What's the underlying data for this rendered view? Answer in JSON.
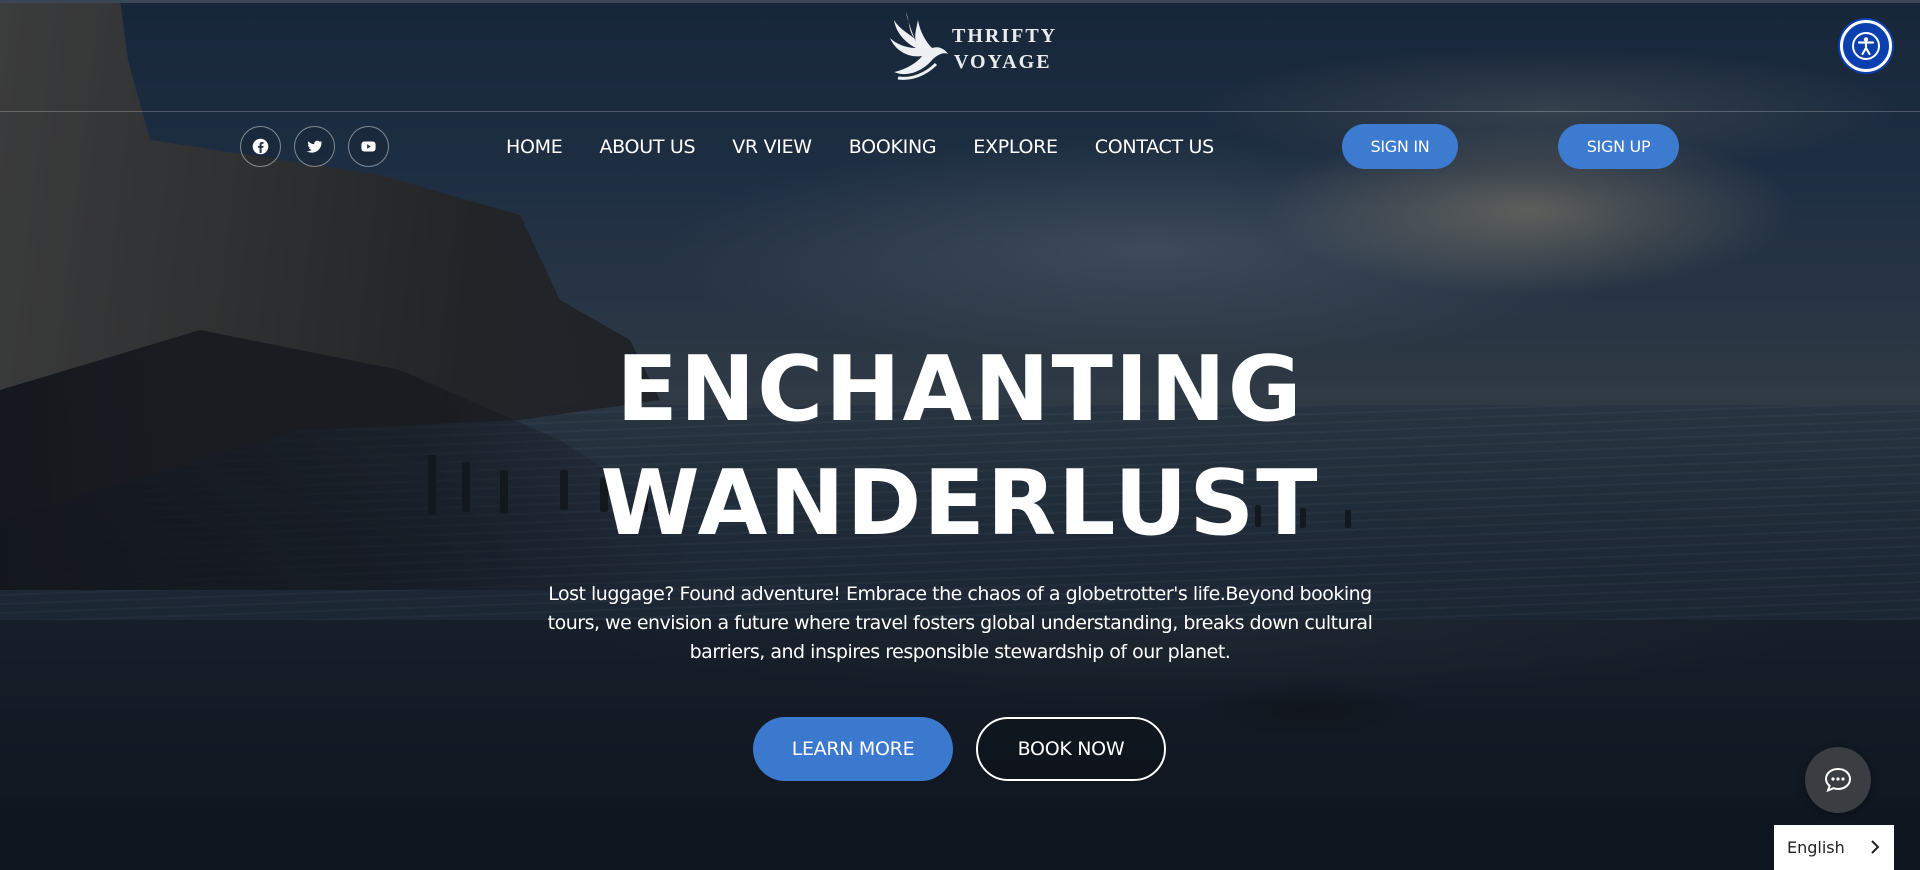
{
  "brand": {
    "line1": "THRIFTY",
    "line2": "VOYAGE",
    "logo_icon": "dove-icon"
  },
  "socials": [
    {
      "icon": "facebook-icon"
    },
    {
      "icon": "twitter-icon"
    },
    {
      "icon": "youtube-icon"
    }
  ],
  "nav": {
    "items": [
      {
        "label": "HOME"
      },
      {
        "label": "ABOUT US"
      },
      {
        "label": "VR VIEW"
      },
      {
        "label": "BOOKING"
      },
      {
        "label": "EXPLORE"
      },
      {
        "label": "CONTACT US"
      }
    ]
  },
  "auth": {
    "signin_label": "SIGN IN",
    "signup_label": "SIGN UP"
  },
  "hero": {
    "title_line1": "ENCHANTING",
    "title_line2": "WANDERLUST",
    "description": "Lost luggage? Found adventure! Embrace the chaos of a globetrotter's life.Beyond booking tours, we envision a future where travel fosters global understanding, breaks down cultural barriers, and inspires responsible stewardship of our planet.",
    "learn_more_label": "LEARN MORE",
    "book_now_label": "BOOK NOW"
  },
  "widgets": {
    "accessibility_icon": "accessibility-icon",
    "chat_icon": "chat-bubble-icon",
    "language": "English"
  },
  "colors": {
    "accent": "#3d7bd0",
    "accessibility": "#0a3fb0"
  }
}
